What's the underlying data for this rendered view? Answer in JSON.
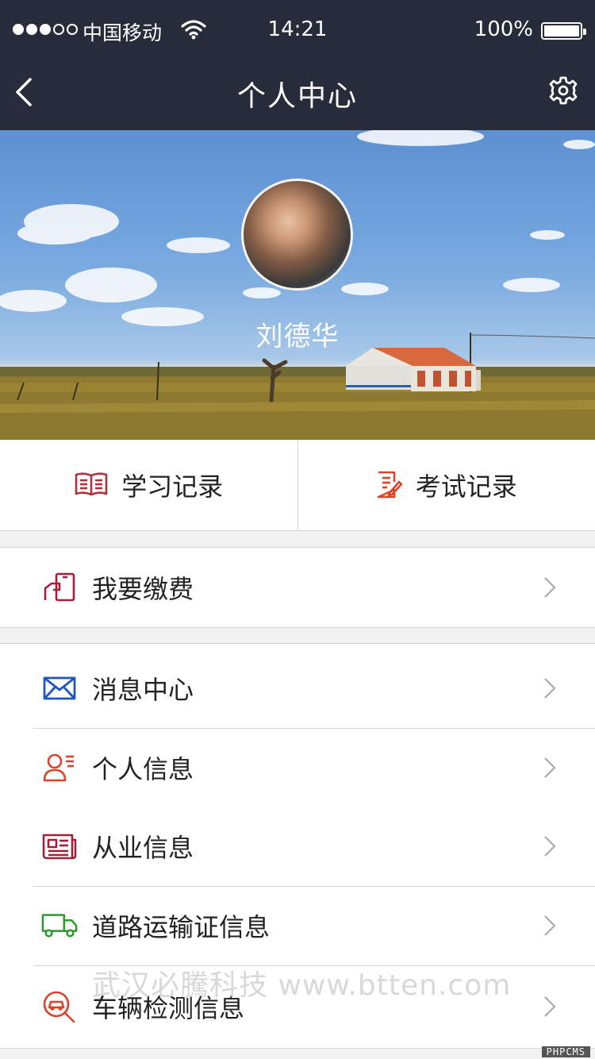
{
  "status_bar": {
    "carrier": "中国移动",
    "time": "14:21",
    "battery": "100%"
  },
  "nav": {
    "title": "个人中心"
  },
  "profile": {
    "name": "刘德华"
  },
  "records": [
    {
      "label": "学习记录",
      "icon": "book-icon",
      "color": "#b0303c"
    },
    {
      "label": "考试记录",
      "icon": "exam-paper-icon",
      "color": "#d9442b"
    }
  ],
  "menu_groups": [
    [
      {
        "label": "我要缴费",
        "icon": "payment-phone-icon",
        "color": "#a3203a"
      }
    ],
    [
      {
        "label": "消息中心",
        "icon": "envelope-icon",
        "color": "#1f56c4"
      },
      {
        "label": "个人信息",
        "icon": "user-card-icon",
        "color": "#d9442b"
      }
    ],
    [
      {
        "label": "从业信息",
        "icon": "newspaper-icon",
        "color": "#a3203a"
      },
      {
        "label": "道路运输证信息",
        "icon": "truck-icon",
        "color": "#2a9a2a"
      },
      {
        "label": "车辆检测信息",
        "icon": "car-search-icon",
        "color": "#d9442b"
      }
    ]
  ],
  "watermark": "武汉必騰科技 www.btten.com",
  "badge": "PHPCMS"
}
